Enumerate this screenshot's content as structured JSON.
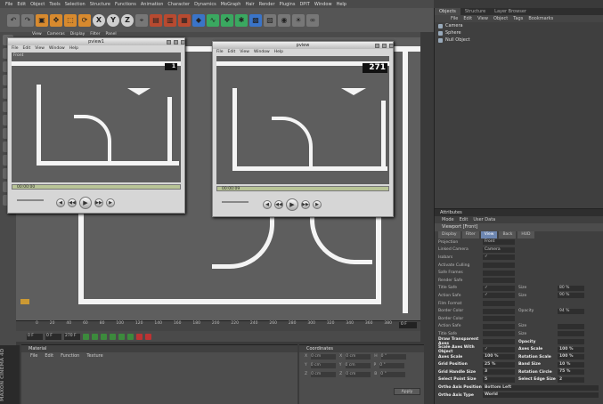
{
  "menubar": [
    "File",
    "Edit",
    "Object",
    "Tools",
    "Selection",
    "Structure",
    "Functions",
    "Animation",
    "Character",
    "Dynamics",
    "MoGraph",
    "Hair",
    "Render",
    "Plugins",
    "DPIT",
    "Window",
    "Help"
  ],
  "toolbar": {
    "axis_x": "X",
    "axis_y": "Y",
    "axis_z": "Z"
  },
  "viewport_menu": [
    "View",
    "Cameras",
    "Display",
    "Filter",
    "Panel"
  ],
  "timeline": {
    "ticks": [
      "0",
      "20",
      "40",
      "60",
      "80",
      "100",
      "120",
      "140",
      "160",
      "180",
      "200",
      "220",
      "240",
      "260",
      "280",
      "300",
      "320",
      "340",
      "360",
      "380"
    ],
    "frame": "0 F"
  },
  "transport": {
    "current": "0 F",
    "start": "0 F",
    "end": "270 F"
  },
  "material": {
    "title": "Material",
    "menu": [
      "File",
      "Edit",
      "Function",
      "Texture"
    ]
  },
  "coordinates": {
    "title": "Coordinates",
    "rows": [
      [
        "X",
        "0 cm",
        "X",
        "0 cm",
        "H",
        "0 °"
      ],
      [
        "Y",
        "0 cm",
        "Y",
        "0 cm",
        "P",
        "0 °"
      ],
      [
        "Z",
        "0 cm",
        "Z",
        "0 cm",
        "B",
        "0 °"
      ]
    ],
    "apply": "Apply"
  },
  "maxon": "MAXON CINEMA 4D",
  "objects": {
    "tabs": [
      "Objects",
      "Structure",
      "Layer Browser"
    ],
    "menu": [
      "File",
      "Edit",
      "View",
      "Object",
      "Tags",
      "Bookmarks"
    ],
    "items": [
      "Camera",
      "Sphere",
      "Null Object"
    ]
  },
  "attributes": {
    "title": "Attributes",
    "menu": [
      "Mode",
      "Edit",
      "User Data"
    ],
    "object": "Viewport [Front]",
    "tabs": [
      "Display",
      "Filter",
      "View",
      "Back",
      "HUD"
    ],
    "rows": [
      {
        "l": "Projection",
        "v": "Front"
      },
      {
        "l": "Linked Camera",
        "v": "Camera"
      },
      {
        "l": "Isobars",
        "v": "✓"
      },
      {
        "l": "Activate Culling",
        "v": ""
      },
      {
        "l": "Safe Frames",
        "v": ""
      },
      {
        "l": "Render Safe",
        "v": ""
      },
      {
        "l": "Title Safe",
        "v": "✓",
        "l2": "Size",
        "v2": "80 %"
      },
      {
        "l": "Action Safe",
        "v": "✓",
        "l2": "Size",
        "v2": "90 %"
      },
      {
        "l": "Film Format",
        "v": ""
      },
      {
        "l": "Border Color",
        "v": "",
        "l2": "Opacity",
        "v2": "94 %"
      },
      {
        "l": "Border Color",
        "v": ""
      },
      {
        "l": "Action Safe",
        "v": "",
        "l2": "Size",
        "v2": ""
      },
      {
        "l": "Title Safe",
        "v": "",
        "l2": "Size",
        "v2": ""
      },
      {
        "l": "Draw Transparent Axes",
        "v": "",
        "l2": "Opacity",
        "v2": ""
      },
      {
        "l": "Scale Axes With Object",
        "v": "✓",
        "l2": "Axes Scale",
        "v2": "100 %"
      },
      {
        "l": "Axes Scale",
        "v": "100 %",
        "l2": "Rotation Scale",
        "v2": "100 %"
      },
      {
        "l": "Grid Position",
        "v": "25 %",
        "l2": "Band Size",
        "v2": "10 %"
      },
      {
        "l": "Grid Handle Size",
        "v": "3",
        "l2": "Rotation Circle",
        "v2": "75 %"
      },
      {
        "l": "Select Point Size",
        "v": "5",
        "l2": "Select Edge Size",
        "v2": "2"
      },
      {
        "l": "Ortho Axis Position",
        "wide": "Bottom Left"
      },
      {
        "l": "Ortho Axis Type",
        "wide": "World"
      }
    ]
  },
  "pview1": {
    "title": "pview1",
    "menu": [
      "File",
      "Edit",
      "View",
      "Window",
      "Help"
    ],
    "frame": "1",
    "time": "00:00:00",
    "overlay": "Front"
  },
  "pview2": {
    "title": "pview",
    "menu": [
      "File",
      "Edit",
      "View",
      "Window",
      "Help"
    ],
    "frame": "271",
    "time": "00:00:09"
  }
}
